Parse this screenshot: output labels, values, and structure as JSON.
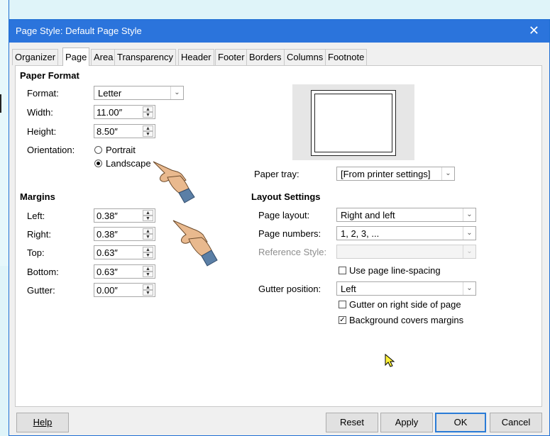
{
  "window": {
    "title": "Page Style: Default Page Style",
    "close_glyph": "✕"
  },
  "tabs": [
    {
      "label": "Organizer"
    },
    {
      "label": "Page"
    },
    {
      "label": "Area"
    },
    {
      "label": "Transparency"
    },
    {
      "label": "Header"
    },
    {
      "label": "Footer"
    },
    {
      "label": "Borders"
    },
    {
      "label": "Columns"
    },
    {
      "label": "Footnote"
    }
  ],
  "active_tab": "Page",
  "paper_format": {
    "heading": "Paper Format",
    "format": {
      "label": "Format:",
      "value": "Letter"
    },
    "width": {
      "label": "Width:",
      "value": "11.00″"
    },
    "height": {
      "label": "Height:",
      "value": "8.50″"
    },
    "orientation": {
      "label": "Orientation:",
      "portrait": "Portrait",
      "landscape": "Landscape",
      "selected": "Landscape"
    }
  },
  "paper_tray": {
    "label": "Paper tray:",
    "value": "[From printer settings]"
  },
  "margins": {
    "heading": "Margins",
    "left": {
      "label": "Left:",
      "value": "0.38″"
    },
    "right": {
      "label": "Right:",
      "value": "0.38″"
    },
    "top": {
      "label": "Top:",
      "value": "0.63″"
    },
    "bottom": {
      "label": "Bottom:",
      "value": "0.63″"
    },
    "gutter": {
      "label": "Gutter:",
      "value": "0.00″"
    }
  },
  "layout_settings": {
    "heading": "Layout Settings",
    "page_layout": {
      "label": "Page layout:",
      "value": "Right and left"
    },
    "page_numbers": {
      "label": "Page numbers:",
      "value": "1, 2, 3, ..."
    },
    "reference_style": {
      "label": "Reference Style:",
      "value": ""
    },
    "use_line_spacing": {
      "label": "Use page line-spacing",
      "checked": false
    },
    "gutter_position": {
      "label": "Gutter position:",
      "value": "Left"
    },
    "gutter_right_side": {
      "label": "Gutter on right side of page",
      "checked": false
    },
    "background_covers_margins": {
      "label": "Background covers margins",
      "checked": true
    }
  },
  "buttons": {
    "help": "Help",
    "reset": "Reset",
    "apply": "Apply",
    "ok": "OK",
    "cancel": "Cancel"
  },
  "colors": {
    "titlebar": "#2b74dc",
    "accent": "#2a7bd6",
    "hand": "#e9b98e",
    "cuff": "#5b7fa6",
    "cursor": "#fff23a"
  },
  "icons": {
    "pointing_hand_1": "pointing-hand",
    "pointing_hand_2": "pointing-hand",
    "mouse_cursor": "arrow-cursor"
  }
}
